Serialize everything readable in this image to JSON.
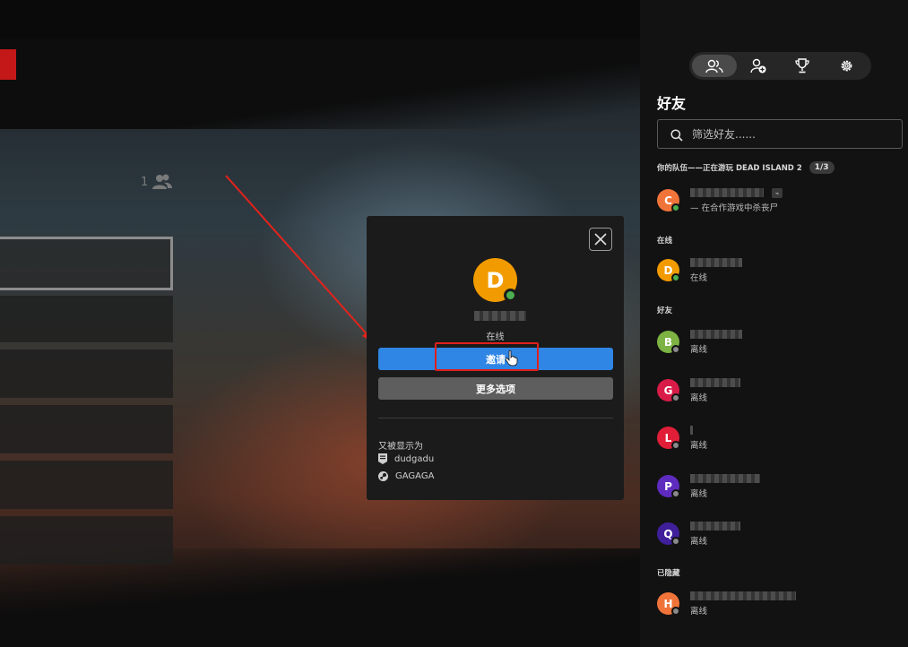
{
  "popup": {
    "avatar_letter": "D",
    "status": "在线",
    "invite_label": "邀请",
    "more_label": "更多选项",
    "shown_as_label": "又被显示为",
    "accounts": [
      {
        "platform_icon": "epic-icon",
        "name": "dudgadu"
      },
      {
        "platform_icon": "steam-icon",
        "name": "GAGAGA"
      }
    ]
  },
  "game": {
    "party_count": "1"
  },
  "friends_panel": {
    "tabs": [
      {
        "icon": "friends-icon",
        "active": true
      },
      {
        "icon": "add-friend-icon",
        "active": false
      },
      {
        "icon": "trophy-icon",
        "active": false
      },
      {
        "icon": "settings-gear-icon",
        "active": false
      }
    ],
    "title": "好友",
    "search_placeholder": "筛选好友......",
    "party": {
      "header": "你的队伍——正在游玩 DEAD ISLAND 2",
      "count": "1/3",
      "members": [
        {
          "letter": "C",
          "color": "#f0743a",
          "status": "— 在合作游戏中杀丧尸",
          "dot_color": "#4caf50"
        }
      ]
    },
    "online": {
      "header": "在线",
      "members": [
        {
          "letter": "D",
          "color": "#f29b00",
          "status": "在线",
          "dot_color": "#4caf50"
        }
      ]
    },
    "friends": {
      "header": "好友",
      "members": [
        {
          "letter": "B",
          "color": "#7cb342",
          "status": "离线",
          "dot_color": "#8a8a8a"
        },
        {
          "letter": "G",
          "color": "#d81b48",
          "status": "离线",
          "dot_color": "#8a8a8a"
        },
        {
          "letter": "L",
          "color": "#e01e37",
          "status": "离线",
          "dot_color": "#8a8a8a"
        },
        {
          "letter": "P",
          "color": "#5e2bbf",
          "status": "离线",
          "dot_color": "#8a8a8a"
        },
        {
          "letter": "Q",
          "color": "#3f1f9a",
          "status": "离线",
          "dot_color": "#8a8a8a"
        }
      ]
    },
    "hidden": {
      "header": "已隐藏",
      "members": [
        {
          "letter": "H",
          "color": "#f0743a",
          "status": "离线",
          "dot_color": "#8a8a8a"
        }
      ]
    }
  }
}
